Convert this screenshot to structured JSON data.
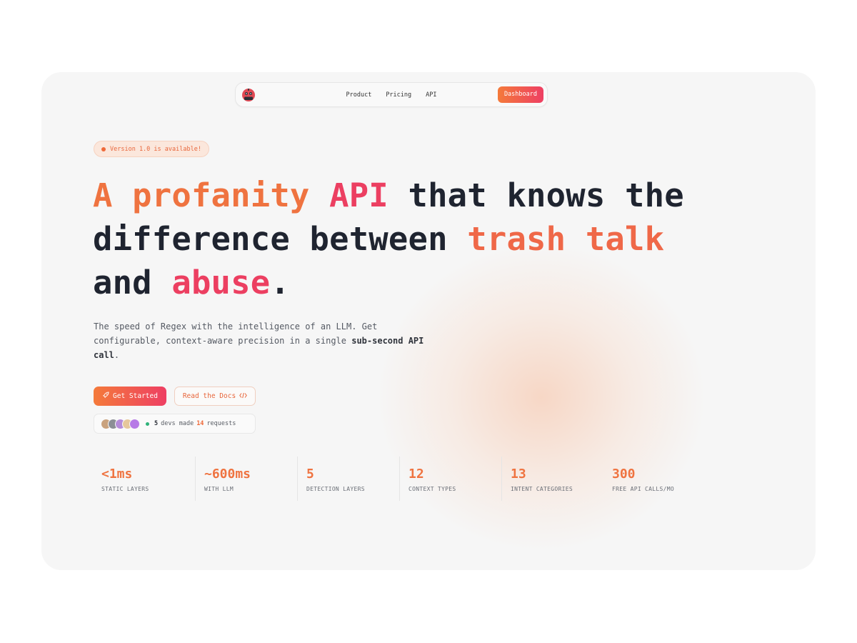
{
  "nav": {
    "links": [
      "Product",
      "Pricing",
      "API"
    ],
    "dashboard_label": "Dashboard"
  },
  "badge": {
    "text": "Version 1.0 is available!"
  },
  "hero": {
    "parts": [
      {
        "text": "A profanity",
        "color": "orange"
      },
      {
        "text": " ",
        "color": "dark"
      },
      {
        "text": "API",
        "color": "pink"
      },
      {
        "text": " that knows the difference between ",
        "color": "dark"
      },
      {
        "text": "trash talk",
        "color": "orange"
      },
      {
        "text": " and ",
        "color": "dark"
      },
      {
        "text": "abuse",
        "color": "pink"
      },
      {
        "text": ".",
        "color": "dark"
      }
    ]
  },
  "subtitle": {
    "text_before": "The speed of Regex with the intelligence of an LLM. Get configurable, context-aware precision in a single ",
    "bold": "sub-second API call",
    "text_after": "."
  },
  "cta": {
    "primary_label": "Get Started",
    "secondary_label": "Read the Docs"
  },
  "activity": {
    "dev_count": "5",
    "middle_text": "devs made",
    "request_count": "14",
    "end_text": "requests"
  },
  "metrics": [
    {
      "value": "<1ms",
      "label": "STATIC LAYERS"
    },
    {
      "value": "~600ms",
      "label": "WITH LLM"
    },
    {
      "value": "5",
      "label": "DETECTION LAYERS"
    },
    {
      "value": "12",
      "label": "CONTEXT TYPES"
    },
    {
      "value": "13",
      "label": "INTENT CATEGORIES"
    },
    {
      "value": "300",
      "label": "FREE API CALLS/MO"
    }
  ],
  "colors": {
    "accent_orange": "#ef7340",
    "accent_pink": "#ec3f61",
    "text_dark": "#1f2430"
  },
  "icons": {
    "logo": "robot-face-icon",
    "primary_cta": "rocket-icon",
    "secondary_cta": "code-icon"
  }
}
